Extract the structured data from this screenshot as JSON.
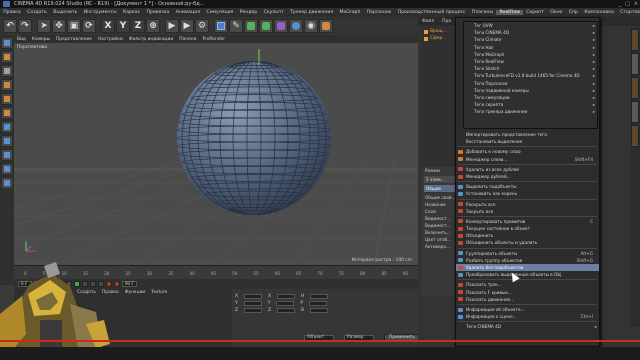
{
  "app": {
    "window_title": "CINEMA 4D R19.024 Studio (RC - R19) - [Документ 1 *] - Основной:ру-бд...",
    "window_buttons": [
      "_",
      "□",
      "×"
    ]
  },
  "menubar": [
    "Правка",
    "Создать",
    "Выделить",
    "Инструменты",
    "Каркас",
    "Привязка",
    "Анимация",
    "Симуляция",
    "Рендер",
    "Скульпт",
    "Трекер движения",
    "MoGraph",
    "Персонаж",
    "Производственный процесс",
    "Плагины",
    "RealFlow",
    "Скрипт",
    "Окно",
    "Спр",
    "Компоновка",
    "Стартовое"
  ],
  "menubar_active": "RealFlow",
  "toolbar": {
    "axis_labels": [
      "X",
      "Y",
      "Z"
    ]
  },
  "viewport": {
    "menu": [
      "Вид",
      "Камеры",
      "Представление",
      "Настройки",
      "Фильтр индикации",
      "Панели",
      "ProRender"
    ],
    "label": "Перспектива",
    "info": "Интервал растра : 100 cm"
  },
  "timeline": {
    "ticks": [
      "0",
      "5",
      "10",
      "15",
      "20",
      "25",
      "30",
      "35",
      "40",
      "45",
      "50",
      "55",
      "60",
      "65",
      "70",
      "75",
      "80",
      "85",
      "90"
    ]
  },
  "playback": {
    "start_frame": "0 F",
    "end_frame": "90 F"
  },
  "materials": {
    "menu": [
      "Создать",
      "Правка",
      "Функции",
      "Texture"
    ]
  },
  "coordinates": {
    "rows": [
      {
        "a": "X",
        "b": "X",
        "c": "H"
      },
      {
        "a": "Y",
        "b": "Y",
        "c": "P"
      },
      {
        "a": "Z",
        "b": "Z",
        "c": "B"
      }
    ],
    "mode_select": "Объект",
    "size_select": "Размер",
    "apply": "Применить"
  },
  "right_panel": {
    "tabs": [
      "Файл",
      "Пра"
    ],
    "objects": [
      "Вращ...",
      "Сфер..."
    ],
    "attr": {
      "mode": "Режим",
      "object_btn": "2 элем...",
      "selected_tab": "Общие",
      "header": "Общие свой...",
      "rows": [
        "Название",
        "Слой",
        "Видимост...",
        "Видимост...",
        "Включить...",
        "Цвет отоб...",
        "Активиро..."
      ]
    }
  },
  "submenu": {
    "items": [
      "Тег UVW",
      "Теги CINEMA 4D",
      "Теги Climate",
      "Теги Hair",
      "Теги MoGraph",
      "Теги RealFlow",
      "Теги Sketch",
      "Теги TurbulenceFD v1.0 build 1465 for Cinema 4D",
      "Теги Персонаж",
      "Теги подвижной камеры",
      "Теги симуляции",
      "Теги скрипта",
      "Теги трекера движения"
    ]
  },
  "context_menu": {
    "items": [
      {
        "label": "Импортировать представление тега",
        "shortcut": "",
        "icon": ""
      },
      {
        "label": "Восстановить выделение",
        "shortcut": "",
        "icon": ""
      },
      {
        "sep": true
      },
      {
        "label": "Добавить к новому слою",
        "shortcut": "",
        "icon": "#d77a2c"
      },
      {
        "label": "Менеджер слоев...",
        "shortcut": "Shift+F4",
        "icon": "#d77a2c"
      },
      {
        "sep": true
      },
      {
        "label": "Удалить из всех дублей",
        "shortcut": "",
        "icon": "#c24a3a"
      },
      {
        "label": "Менеджер дублей...",
        "shortcut": "",
        "icon": "#c24a3a"
      },
      {
        "sep": true
      },
      {
        "label": "Выделить подобъекты",
        "shortcut": "",
        "icon": "#5a8fd0"
      },
      {
        "label": "Установить как корень",
        "shortcut": "",
        "icon": "#5a8fd0"
      },
      {
        "sep": true
      },
      {
        "label": "Раскрыть все",
        "shortcut": "",
        "icon": "#c24a3a"
      },
      {
        "label": "Закрыть все",
        "shortcut": "",
        "icon": "#c24a3a"
      },
      {
        "sep": true
      },
      {
        "label": "Конвертировать примитив",
        "shortcut": "C",
        "icon": "#c24a3a"
      },
      {
        "label": "Текущее состояние в объект",
        "shortcut": "",
        "icon": "#c24a3a"
      },
      {
        "label": "Объединить",
        "shortcut": "",
        "icon": "#c24a3a"
      },
      {
        "label": "Объединить объекты и удалить",
        "shortcut": "",
        "icon": "#c24a3a"
      },
      {
        "sep": true
      },
      {
        "label": "Группировать объекты",
        "shortcut": "Alt+G",
        "icon": "#5a8fd0"
      },
      {
        "label": "Разбить группу объектов",
        "shortcut": "Shift+G",
        "icon": "#5a8fd0"
      },
      {
        "label": "Удалить без подобъектов",
        "shortcut": "",
        "icon": "#c24a3a",
        "highlight": true
      },
      {
        "label": "Преобразовать выделенные объекты в Obj",
        "shortcut": "",
        "icon": "#5a8fd0"
      },
      {
        "sep": true
      },
      {
        "label": "Показать трэк...",
        "shortcut": "",
        "icon": "#c24a3a"
      },
      {
        "label": "Показать F кривые...",
        "shortcut": "",
        "icon": "#c24a3a"
      },
      {
        "label": "Показать движение...",
        "shortcut": "",
        "icon": "#c24a3a"
      },
      {
        "sep": true
      },
      {
        "label": "Информация об объекте...",
        "shortcut": "",
        "icon": "#5a8fd0"
      },
      {
        "label": "Информация о сцене...",
        "shortcut": "Ctrl+I",
        "icon": "#5a8fd0"
      },
      {
        "sep": true
      },
      {
        "label": "Теги CINEMA 4D",
        "shortcut": "",
        "icon": "",
        "arrow": true
      }
    ]
  },
  "colors": {
    "menu_highlight": "#6b7fa3",
    "status_red": "#d2291f",
    "sphere": "#586a84"
  }
}
